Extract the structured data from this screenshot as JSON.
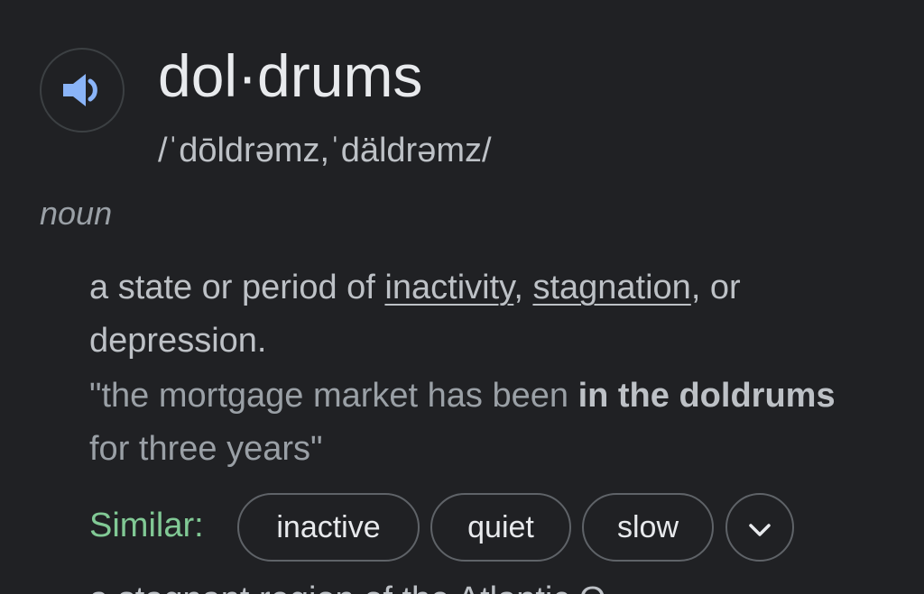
{
  "entry": {
    "headword": "dol·drums",
    "phonetic": "/ˈdōldrəmz,ˈdäldrəmz/",
    "part_of_speech": "noun"
  },
  "sense": {
    "def_start": "a state or period of ",
    "link_1": "inactivity",
    "def_sep": ", ",
    "link_2": "stagnation",
    "def_end": ", or depression.",
    "example_start": "\"the mortgage market has been ",
    "example_bold": "in the doldrums",
    "example_end": " for three years\""
  },
  "similar": {
    "label": "Similar:",
    "chips": [
      "inactive",
      "quiet",
      "slow"
    ]
  },
  "next_sense_partial": "a stagnant region of the Atlantic O",
  "icons": {
    "pronounce": "speaker-icon",
    "expand": "chevron-down-icon"
  },
  "colors": {
    "background": "#202124",
    "similar_label": "#81c995",
    "speaker_icon": "#8ab4f8"
  }
}
